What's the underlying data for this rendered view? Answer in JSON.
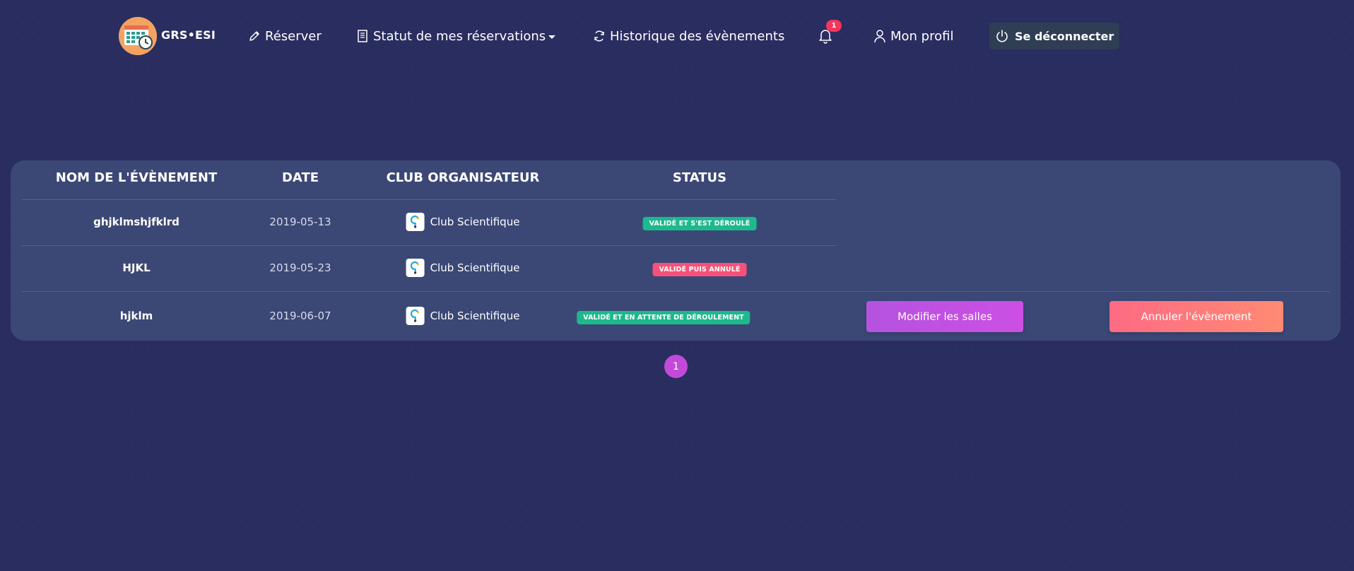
{
  "brand": {
    "name": "GRS•ESI",
    "logo_icon": "calendar-clock-icon"
  },
  "nav": {
    "reserver": "Réserver",
    "statut": "Statut de mes réservations",
    "historique": "Historique des évènements",
    "notifications_count": "1",
    "profil": "Mon profil",
    "logout": "Se déconnecter"
  },
  "table": {
    "headers": [
      "NOM DE L'ÉVÈNEMENT",
      "DATE",
      "CLUB ORGANISATEUR",
      "STATUS"
    ],
    "rows": [
      {
        "name": "ghjklmshjfklrd",
        "date": "2019-05-13",
        "club": "Club Scientifique",
        "status": "VALIDÉ ET S'EST DÉROULÉ",
        "status_color": "#1db98c"
      },
      {
        "name": "HJKL",
        "date": "2019-05-23",
        "club": "Club Scientifique",
        "status": "VALIDÉ PUIS ANNULÉ",
        "status_color": "#f5517a"
      },
      {
        "name": "hjklm",
        "date": "2019-06-07",
        "club": "Club Scientifique",
        "status": "VALIDÉ ET EN ATTENTE DE DÉROULEMENT",
        "status_color": "#1db98c",
        "actions": {
          "modify": "Modifier les salles",
          "cancel": "Annuler l'évènement"
        }
      }
    ]
  },
  "pagination": {
    "current": "1"
  },
  "colors": {
    "background": "#2a2d5f",
    "card": "#3b4876",
    "accent_purple": "#c34ad9",
    "accent_coral": "#fe6b84",
    "success": "#1db98c",
    "danger": "#f5517a"
  }
}
